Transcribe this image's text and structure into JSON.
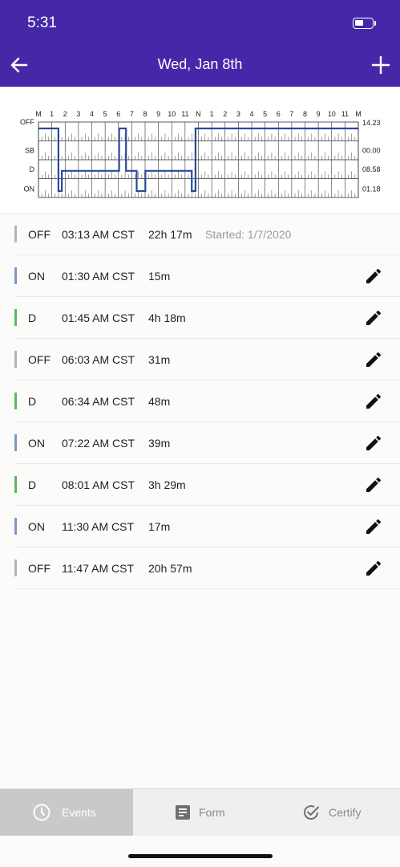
{
  "status_bar": {
    "time": "5:31"
  },
  "header": {
    "title": "Wed, Jan 8th"
  },
  "chart_data": {
    "type": "line",
    "hour_labels": [
      "M",
      "1",
      "2",
      "3",
      "4",
      "5",
      "6",
      "7",
      "8",
      "9",
      "10",
      "11",
      "N",
      "1",
      "2",
      "3",
      "4",
      "5",
      "6",
      "7",
      "8",
      "9",
      "10",
      "11",
      "M"
    ],
    "rows": [
      "OFF",
      "SB",
      "D",
      "ON"
    ],
    "totals": [
      "14.23",
      "00.00",
      "08.58",
      "01.18"
    ],
    "segments": [
      {
        "status": "OFF",
        "start": 0.0,
        "end": 1.5
      },
      {
        "status": "ON",
        "start": 1.5,
        "end": 1.75
      },
      {
        "status": "D",
        "start": 1.75,
        "end": 6.05
      },
      {
        "status": "OFF",
        "start": 6.05,
        "end": 6.567
      },
      {
        "status": "D",
        "start": 6.567,
        "end": 7.367
      },
      {
        "status": "ON",
        "start": 7.367,
        "end": 8.017
      },
      {
        "status": "D",
        "start": 8.017,
        "end": 11.5
      },
      {
        "status": "ON",
        "start": 11.5,
        "end": 11.783
      },
      {
        "status": "OFF",
        "start": 11.783,
        "end": 24.0
      }
    ]
  },
  "events": [
    {
      "status": "OFF",
      "time": "03:13 AM CST",
      "duration": "22h 17m",
      "note": "Started: 1/7/2020",
      "color": "#b4b4b4",
      "editable": false
    },
    {
      "status": "ON",
      "time": "01:30 AM CST",
      "duration": "15m",
      "note": "",
      "color": "#8096c8",
      "editable": true
    },
    {
      "status": "D",
      "time": "01:45 AM CST",
      "duration": "4h 18m",
      "note": "",
      "color": "#5cb85c",
      "editable": true
    },
    {
      "status": "OFF",
      "time": "06:03 AM CST",
      "duration": "31m",
      "note": "",
      "color": "#b4b4b4",
      "editable": true
    },
    {
      "status": "D",
      "time": "06:34 AM CST",
      "duration": "48m",
      "note": "",
      "color": "#5cb85c",
      "editable": true
    },
    {
      "status": "ON",
      "time": "07:22 AM CST",
      "duration": "39m",
      "note": "",
      "color": "#8096c8",
      "editable": true
    },
    {
      "status": "D",
      "time": "08:01 AM CST",
      "duration": "3h 29m",
      "note": "",
      "color": "#5cb85c",
      "editable": true
    },
    {
      "status": "ON",
      "time": "11:30 AM CST",
      "duration": "17m",
      "note": "",
      "color": "#8096c8",
      "editable": true
    },
    {
      "status": "OFF",
      "time": "11:47 AM CST",
      "duration": "20h 57m",
      "note": "",
      "color": "#b4b4b4",
      "editable": true
    }
  ],
  "tabs": [
    {
      "label": "Events",
      "icon": "clock-icon",
      "active": true
    },
    {
      "label": "Form",
      "icon": "form-icon",
      "active": false
    },
    {
      "label": "Certify",
      "icon": "check-circle-icon",
      "active": false
    }
  ],
  "colors": {
    "header": "#4528a8",
    "graph_line": "#2b4a9c"
  }
}
